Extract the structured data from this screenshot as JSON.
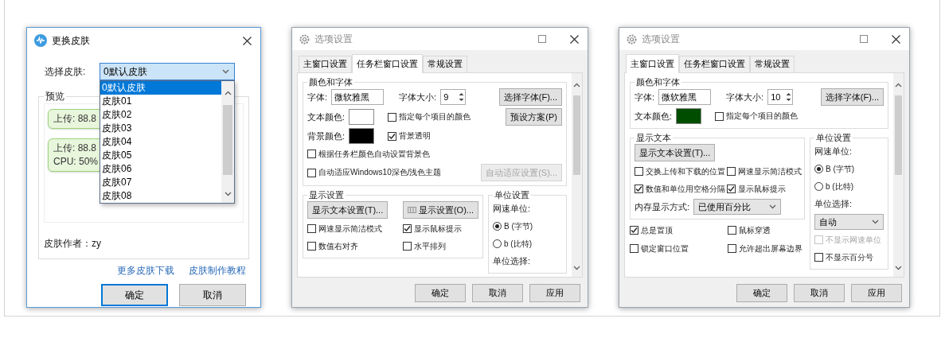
{
  "dialogs": [
    {
      "kind": "skin",
      "title": "更换皮肤",
      "controls": [
        {
          "kind": "close"
        }
      ],
      "select_label": "选择皮肤:",
      "select_value": "0默认皮肤",
      "dropdown": [
        {
          "label": "0默认皮肤",
          "selected": true
        },
        {
          "label": "皮肤01",
          "selected": false
        },
        {
          "label": "皮肤02",
          "selected": false
        },
        {
          "label": "皮肤03",
          "selected": false
        },
        {
          "label": "皮肤04",
          "selected": false
        },
        {
          "label": "皮肤05",
          "selected": false
        },
        {
          "label": "皮肤06",
          "selected": false
        },
        {
          "label": "皮肤07",
          "selected": false
        },
        {
          "label": "皮肤08",
          "selected": false
        }
      ],
      "preview": {
        "title": "预览",
        "widgets": [
          {
            "lines": [
              "上传: 88.8"
            ]
          },
          {
            "lines": [
              "上传: 88.8",
              "CPU: 50%"
            ]
          }
        ],
        "author": "皮肤作者：zy"
      },
      "links": [
        "更多皮肤下载",
        "皮肤制作教程"
      ],
      "buttons": [
        {
          "label": "确定",
          "focused": true
        },
        {
          "label": "取消",
          "focused": false
        }
      ]
    },
    {
      "kind": "options",
      "title": "选项设置",
      "controls": [
        {
          "kind": "maximize"
        },
        {
          "kind": "close"
        }
      ],
      "tabs": [
        {
          "label": "主窗口设置",
          "selected": false
        },
        {
          "label": "任务栏窗口设置",
          "selected": true
        },
        {
          "label": "常规设置",
          "selected": false
        }
      ],
      "sections": [
        {
          "kind": "group",
          "title": "颜色和字体",
          "rows": [
            {
              "items": [
                {
                  "kind": "label",
                  "text": "字体:"
                },
                {
                  "kind": "text_field",
                  "value": "微软雅黑"
                },
                {
                  "kind": "label",
                  "text": "字体大小:"
                },
                {
                  "kind": "spinner",
                  "value": "9"
                },
                {
                  "kind": "button",
                  "label": "选择字体(F)...",
                  "disabled": false
                }
              ]
            },
            {
              "items": [
                {
                  "kind": "label",
                  "text": "文本颜色:"
                },
                {
                  "kind": "swatch",
                  "color": "#ffffff"
                },
                {
                  "kind": "checkbox",
                  "label": "指定每个项目的颜色",
                  "checked": false,
                  "disabled": false
                },
                {
                  "kind": "button",
                  "label": "预设方案(P)",
                  "disabled": false
                }
              ]
            },
            {
              "items": [
                {
                  "kind": "label",
                  "text": "背景颜色:"
                },
                {
                  "kind": "swatch",
                  "color": "#000000"
                },
                {
                  "kind": "checkbox",
                  "label": "背景透明",
                  "checked": true,
                  "disabled": false
                }
              ]
            },
            {
              "items": [
                {
                  "kind": "checkbox",
                  "label": "根据任务栏颜色自动设置背景色",
                  "checked": false,
                  "disabled": false
                }
              ]
            },
            {
              "items": [
                {
                  "kind": "checkbox",
                  "label": "自动适应Windows10深色/浅色主题",
                  "checked": false,
                  "disabled": false
                },
                {
                  "kind": "button",
                  "label": "自动适应设置(S)...",
                  "disabled": true
                }
              ]
            }
          ]
        },
        {
          "kind": "pair",
          "groups": [
            {
              "title": "显示设置",
              "rows": [
                {
                  "items": [
                    {
                      "kind": "button",
                      "label": "显示文本设置(T)...",
                      "disabled": false
                    },
                    {
                      "kind": "icon_button",
                      "label": "显示设置(O)...",
                      "disabled": false
                    }
                  ]
                },
                {
                  "items": [
                    {
                      "kind": "checkbox",
                      "label": "网速显示简洁模式",
                      "checked": false,
                      "disabled": false
                    },
                    {
                      "kind": "checkbox",
                      "label": "显示鼠标提示",
                      "checked": true,
                      "disabled": false
                    }
                  ]
                },
                {
                  "items": [
                    {
                      "kind": "checkbox",
                      "label": "数值右对齐",
                      "checked": false,
                      "disabled": false
                    },
                    {
                      "kind": "checkbox",
                      "label": "水平排列",
                      "checked": false,
                      "disabled": false
                    }
                  ]
                }
              ]
            },
            {
              "title": "单位设置",
              "rows": [
                {
                  "items": [
                    {
                      "kind": "label",
                      "text": "网速单位:"
                    }
                  ]
                },
                {
                  "items": [
                    {
                      "kind": "radio",
                      "label": "B (字节)",
                      "selected": true
                    }
                  ]
                },
                {
                  "items": [
                    {
                      "kind": "radio",
                      "label": "b (比特)",
                      "selected": false
                    }
                  ]
                },
                {
                  "items": [
                    {
                      "kind": "label",
                      "text": "单位选择:"
                    }
                  ]
                }
              ]
            }
          ]
        }
      ],
      "buttons": [
        {
          "label": "确定",
          "focused": false
        },
        {
          "label": "取消",
          "focused": false
        },
        {
          "label": "应用",
          "focused": false
        }
      ]
    },
    {
      "kind": "options",
      "title": "选项设置",
      "controls": [
        {
          "kind": "maximize"
        },
        {
          "kind": "close"
        }
      ],
      "tabs": [
        {
          "label": "主窗口设置",
          "selected": true
        },
        {
          "label": "任务栏窗口设置",
          "selected": false
        },
        {
          "label": "常规设置",
          "selected": false
        }
      ],
      "sections": [
        {
          "kind": "group",
          "title": "颜色和字体",
          "rows": [
            {
              "items": [
                {
                  "kind": "label",
                  "text": "字体:"
                },
                {
                  "kind": "text_field",
                  "value": "微软雅黑"
                },
                {
                  "kind": "label",
                  "text": "字体大小:"
                },
                {
                  "kind": "spinner",
                  "value": "10"
                },
                {
                  "kind": "button",
                  "label": "选择字体(F)...",
                  "disabled": false
                }
              ]
            },
            {
              "items": [
                {
                  "kind": "label",
                  "text": "文本颜色:"
                },
                {
                  "kind": "swatch",
                  "color": "#004d00"
                },
                {
                  "kind": "checkbox",
                  "label": "指定每个项目的颜色",
                  "checked": false,
                  "disabled": false
                }
              ]
            }
          ]
        },
        {
          "kind": "pair",
          "groups": [
            {
              "title": "显示文本",
              "rows": [
                {
                  "items": [
                    {
                      "kind": "button",
                      "label": "显示文本设置(T)...",
                      "disabled": false
                    }
                  ]
                },
                {
                  "items": [
                    {
                      "kind": "checkbox",
                      "label": "交换上传和下载的位置",
                      "checked": false,
                      "disabled": false
                    },
                    {
                      "kind": "checkbox",
                      "label": "网速显示简洁模式",
                      "checked": false,
                      "disabled": false
                    }
                  ]
                },
                {
                  "items": [
                    {
                      "kind": "checkbox",
                      "label": "数值和单位用空格分隔",
                      "checked": true,
                      "disabled": false
                    },
                    {
                      "kind": "checkbox",
                      "label": "显示鼠标提示",
                      "checked": true,
                      "disabled": false
                    }
                  ]
                },
                {
                  "items": [
                    {
                      "kind": "label",
                      "text": "内存显示方式:"
                    },
                    {
                      "kind": "select",
                      "value": "已使用百分比"
                    }
                  ]
                }
              ]
            },
            {
              "title": "单位设置",
              "rows": [
                {
                  "items": [
                    {
                      "kind": "label",
                      "text": "网速单位:"
                    }
                  ]
                },
                {
                  "items": [
                    {
                      "kind": "radio",
                      "label": "B (字节)",
                      "selected": true
                    }
                  ]
                },
                {
                  "items": [
                    {
                      "kind": "radio",
                      "label": "b (比特)",
                      "selected": false
                    }
                  ]
                },
                {
                  "items": [
                    {
                      "kind": "label",
                      "text": "单位选择:"
                    }
                  ]
                },
                {
                  "items": [
                    {
                      "kind": "select",
                      "value": "自动"
                    }
                  ]
                },
                {
                  "items": [
                    {
                      "kind": "checkbox",
                      "label": "不显示网速单位",
                      "checked": false,
                      "disabled": true
                    }
                  ]
                },
                {
                  "items": [
                    {
                      "kind": "checkbox",
                      "label": "不显示百分号",
                      "checked": false,
                      "disabled": false
                    }
                  ]
                }
              ]
            }
          ],
          "rows": [
            {
              "items": [
                {
                  "kind": "checkbox",
                  "label": "总是置顶",
                  "checked": true,
                  "disabled": false
                },
                {
                  "kind": "checkbox",
                  "label": "鼠标穿透",
                  "checked": false,
                  "disabled": false
                }
              ]
            },
            {
              "items": [
                {
                  "kind": "checkbox",
                  "label": "锁定窗口位置",
                  "checked": false,
                  "disabled": false
                },
                {
                  "kind": "checkbox",
                  "label": "允许超出屏幕边界",
                  "checked": false,
                  "disabled": false
                }
              ]
            }
          ]
        }
      ],
      "buttons": [
        {
          "label": "确定",
          "focused": false
        },
        {
          "label": "取消",
          "focused": false
        },
        {
          "label": "应用",
          "focused": false
        }
      ]
    }
  ]
}
